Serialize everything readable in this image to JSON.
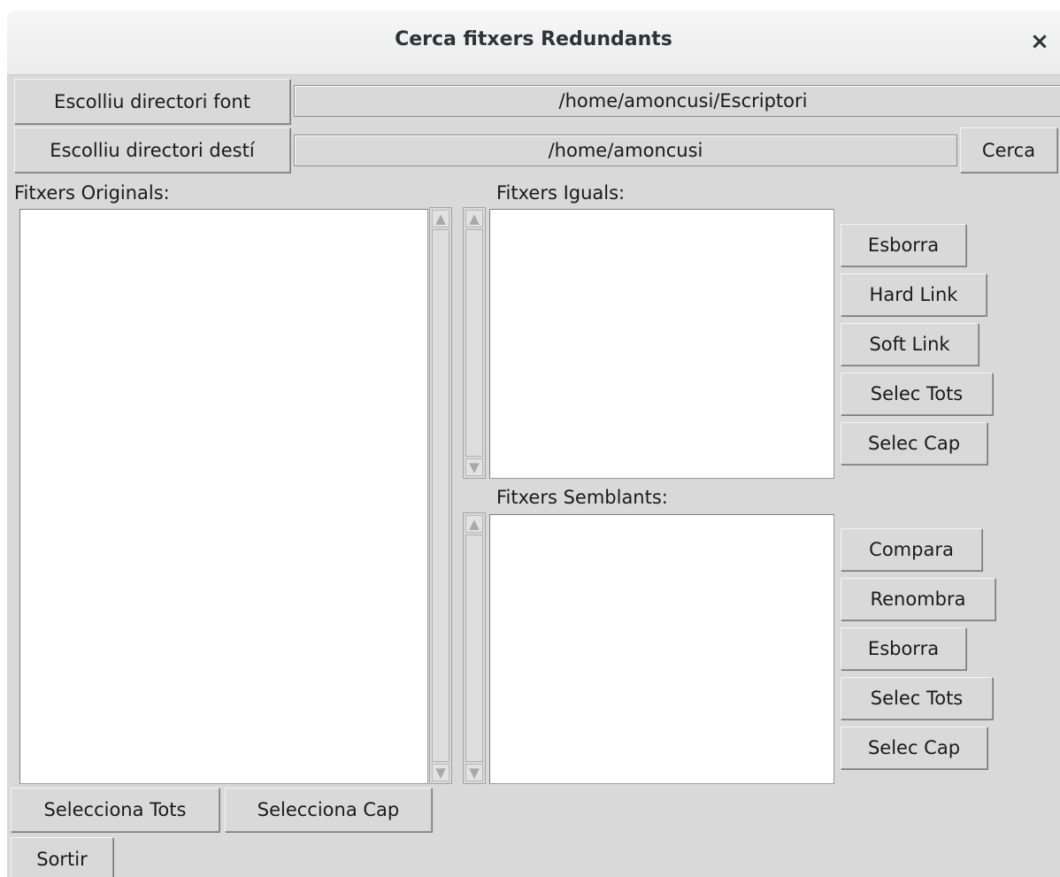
{
  "window": {
    "title": "Cerca fitxers Redundants",
    "close_glyph": "×"
  },
  "source": {
    "button_label": "Escolliu directori font",
    "path": "/home/amoncusi/Escriptori"
  },
  "destination": {
    "button_label": "Escolliu directori destí",
    "path": "/home/amoncusi",
    "search_label": "Cerca"
  },
  "originals": {
    "label": "Fitxers Originals:",
    "items": [],
    "select_all_label": "Selecciona Tots",
    "select_none_label": "Selecciona Cap"
  },
  "equal_files": {
    "label": "Fitxers Iguals:",
    "items": [],
    "buttons": {
      "delete": "Esborra",
      "hard_link": "Hard Link",
      "soft_link": "Soft Link",
      "select_all": "Selec Tots",
      "select_none": "Selec Cap"
    }
  },
  "similar_files": {
    "label": "Fitxers Semblants:",
    "items": [],
    "buttons": {
      "compare": "Compara",
      "rename": "Renombra",
      "delete": "Esborra",
      "select_all": "Selec Tots",
      "select_none": "Selec Cap"
    }
  },
  "footer": {
    "exit_label": "Sortir"
  },
  "icons": {
    "scroll_up": "arrow-up-icon",
    "scroll_down": "arrow-down-icon",
    "close": "close-icon"
  },
  "colors": {
    "window_bg": "#d9d9d9",
    "list_bg": "#ffffff",
    "titlebar_bg": "#ececec"
  }
}
